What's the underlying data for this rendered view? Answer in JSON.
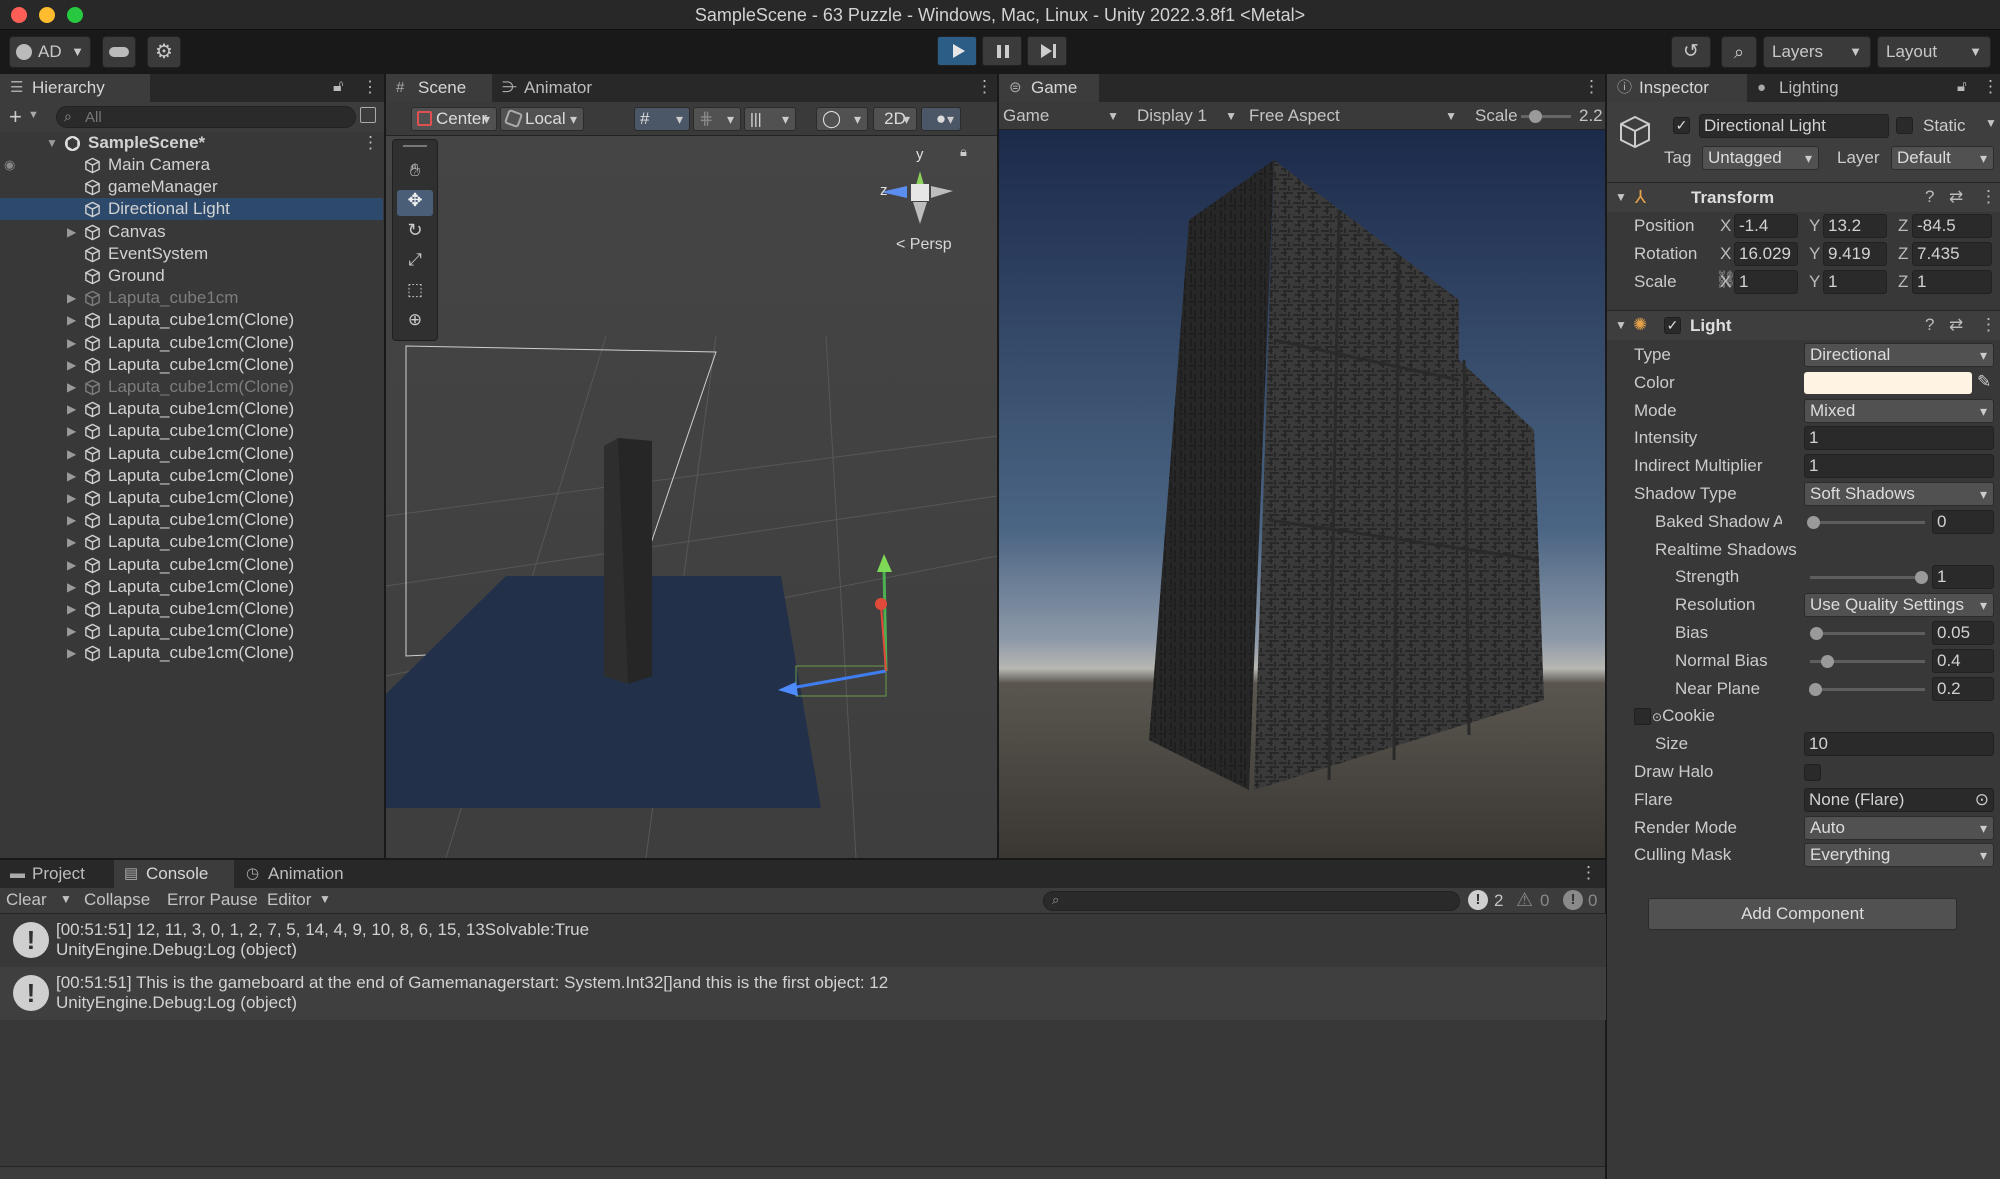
{
  "window": {
    "title": "SampleScene - 63 Puzzle - Windows, Mac, Linux - Unity 2022.3.8f1 <Metal>"
  },
  "toolbar": {
    "account": "AD",
    "layers": "Layers",
    "layout": "Layout"
  },
  "hierarchy": {
    "tab": "Hierarchy",
    "search_placeholder": "All",
    "scene": "SampleScene*",
    "items": [
      {
        "label": "Main Camera",
        "dim": false,
        "expand": false
      },
      {
        "label": "gameManager",
        "dim": false,
        "expand": false
      },
      {
        "label": "Directional Light",
        "dim": false,
        "expand": false,
        "selected": true
      },
      {
        "label": "Canvas",
        "dim": false,
        "expand": true
      },
      {
        "label": "EventSystem",
        "dim": false,
        "expand": false
      },
      {
        "label": "Ground",
        "dim": false,
        "expand": false
      },
      {
        "label": "Laputa_cube1cm",
        "dim": true,
        "expand": true
      },
      {
        "label": "Laputa_cube1cm(Clone)",
        "dim": false,
        "expand": true
      },
      {
        "label": "Laputa_cube1cm(Clone)",
        "dim": false,
        "expand": true
      },
      {
        "label": "Laputa_cube1cm(Clone)",
        "dim": false,
        "expand": true
      },
      {
        "label": "Laputa_cube1cm(Clone)",
        "dim": true,
        "expand": true
      },
      {
        "label": "Laputa_cube1cm(Clone)",
        "dim": false,
        "expand": true
      },
      {
        "label": "Laputa_cube1cm(Clone)",
        "dim": false,
        "expand": true
      },
      {
        "label": "Laputa_cube1cm(Clone)",
        "dim": false,
        "expand": true
      },
      {
        "label": "Laputa_cube1cm(Clone)",
        "dim": false,
        "expand": true
      },
      {
        "label": "Laputa_cube1cm(Clone)",
        "dim": false,
        "expand": true
      },
      {
        "label": "Laputa_cube1cm(Clone)",
        "dim": false,
        "expand": true
      },
      {
        "label": "Laputa_cube1cm(Clone)",
        "dim": false,
        "expand": true
      },
      {
        "label": "Laputa_cube1cm(Clone)",
        "dim": false,
        "expand": true
      },
      {
        "label": "Laputa_cube1cm(Clone)",
        "dim": false,
        "expand": true
      },
      {
        "label": "Laputa_cube1cm(Clone)",
        "dim": false,
        "expand": true
      },
      {
        "label": "Laputa_cube1cm(Clone)",
        "dim": false,
        "expand": true
      },
      {
        "label": "Laputa_cube1cm(Clone)",
        "dim": false,
        "expand": true
      }
    ]
  },
  "scene": {
    "tabs": [
      "Scene",
      "Animator"
    ],
    "pivot": "Center",
    "space": "Local",
    "mode2d": "2D",
    "gizmo": {
      "y": "y",
      "z": "z",
      "persp": "< Persp"
    }
  },
  "game": {
    "tab": "Game",
    "view": "Game",
    "display": "Display 1",
    "aspect": "Free Aspect",
    "scale_label": "Scale",
    "scale_value": "2.2"
  },
  "inspector": {
    "tabs": [
      "Inspector",
      "Lighting"
    ],
    "object_name": "Directional Light",
    "static_label": "Static",
    "tag_label": "Tag",
    "tag": "Untagged",
    "layer_label": "Layer",
    "layer": "Default",
    "transform": {
      "title": "Transform",
      "position": {
        "label": "Position",
        "x": "-1.4",
        "y": "13.2",
        "z": "-84.5"
      },
      "rotation": {
        "label": "Rotation",
        "x": "16.029",
        "y": "9.419",
        "z": "7.435"
      },
      "scale": {
        "label": "Scale",
        "x": "1",
        "y": "1",
        "z": "1"
      }
    },
    "light": {
      "title": "Light",
      "type": {
        "label": "Type",
        "value": "Directional"
      },
      "color": {
        "label": "Color",
        "value": "#fff4e3"
      },
      "mode": {
        "label": "Mode",
        "value": "Mixed"
      },
      "intensity": {
        "label": "Intensity",
        "value": "1"
      },
      "indirect": {
        "label": "Indirect Multiplier",
        "value": "1"
      },
      "shadow_type": {
        "label": "Shadow Type",
        "value": "Soft Shadows"
      },
      "baked_angle": {
        "label": "Baked Shadow An",
        "value": "0",
        "level": 0
      },
      "realtime": "Realtime Shadows",
      "strength": {
        "label": "Strength",
        "value": "1",
        "level": 1
      },
      "resolution": {
        "label": "Resolution",
        "value": "Use Quality Settings"
      },
      "bias": {
        "label": "Bias",
        "value": "0.05",
        "level": 0.025
      },
      "normal_bias": {
        "label": "Normal Bias",
        "value": "0.4",
        "level": 0.13
      },
      "near_plane": {
        "label": "Near Plane",
        "value": "0.2",
        "level": 0.02
      },
      "cookie": {
        "label": "Cookie"
      },
      "size": {
        "label": "Size",
        "value": "10"
      },
      "draw_halo": {
        "label": "Draw Halo"
      },
      "flare": {
        "label": "Flare",
        "value": "None (Flare)"
      },
      "render_mode": {
        "label": "Render Mode",
        "value": "Auto"
      },
      "culling": {
        "label": "Culling Mask",
        "value": "Everything"
      }
    },
    "add_component": "Add Component"
  },
  "bottom": {
    "tabs": [
      "Project",
      "Console",
      "Animation"
    ],
    "clear": "Clear",
    "collapse": "Collapse",
    "error_pause": "Error Pause",
    "editor": "Editor",
    "counts": {
      "logs": "2",
      "warnings": "0",
      "errors": "0"
    },
    "logs": [
      {
        "line1": "[00:51:51] 12, 11, 3, 0, 1, 2, 7, 5, 14, 4, 9, 10, 8, 6, 15, 13Solvable:True",
        "line2": "UnityEngine.Debug:Log (object)"
      },
      {
        "line1": "[00:51:51] This is the gameboard at the end of Gamemanagerstart: System.Int32[]and this is the first object: 12",
        "line2": "UnityEngine.Debug:Log (object)"
      }
    ]
  }
}
